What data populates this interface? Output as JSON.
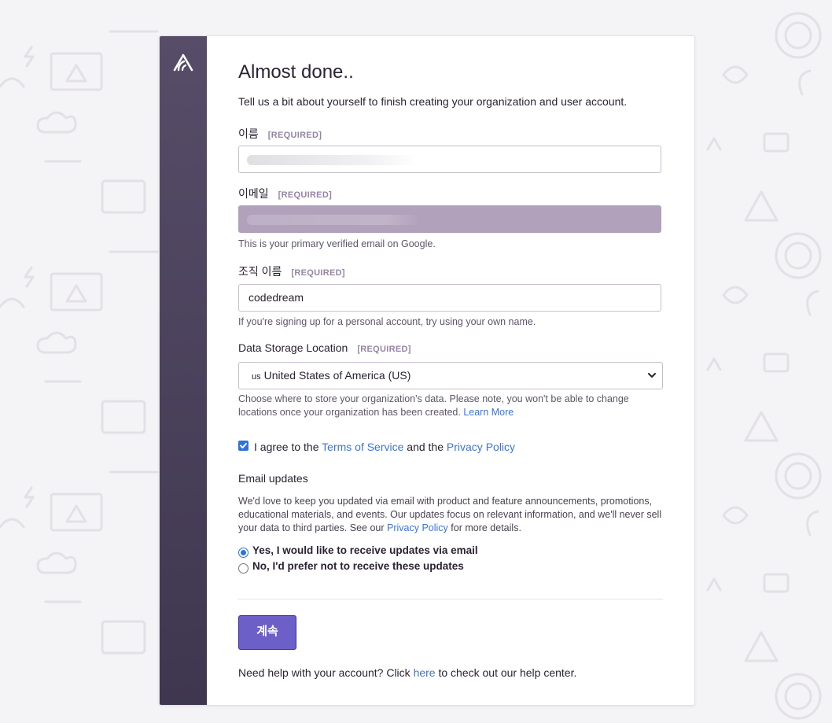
{
  "header": {
    "title": "Almost done..",
    "subtitle": "Tell us a bit about yourself to finish creating your organization and user account."
  },
  "form": {
    "name": {
      "label": "이름",
      "required": "[REQUIRED]",
      "value": ""
    },
    "email": {
      "label": "이메일",
      "required": "[REQUIRED]",
      "value": "",
      "help": "This is your primary verified email on Google."
    },
    "org": {
      "label": "조직 이름",
      "required": "[REQUIRED]",
      "value": "codedream",
      "help": "If you're signing up for a personal account, try using your own name."
    },
    "storage": {
      "label": "Data Storage Location",
      "required": "[REQUIRED]",
      "flag": "us",
      "selected": "United States of America (US)",
      "help": "Choose where to store your organization's data. Please note, you won't be able to change locations once your organization has been created.",
      "help_link": "Learn More"
    },
    "terms": {
      "checked": true,
      "prefix": "I agree to the",
      "terms_link": "Terms of Service",
      "middle": "and the",
      "privacy_link": "Privacy Policy"
    },
    "updates": {
      "title": "Email updates",
      "description": "We'd love to keep you updated via email with product and feature announcements, promotions, educational materials, and events. Our updates focus on relevant information, and we'll never sell your data to third parties. See our",
      "privacy_link": "Privacy Policy",
      "description_suffix": "for more details.",
      "options": [
        {
          "label": "Yes, I would like to receive updates via email",
          "checked": true
        },
        {
          "label": "No, I'd prefer not to receive these updates",
          "checked": false
        }
      ]
    },
    "submit_label": "계속"
  },
  "footer": {
    "prefix": "Need help with your account? Click",
    "link": "here",
    "suffix": "to check out our help center."
  },
  "colors": {
    "sidebar": "#4b4259",
    "accent": "#6c5fc7",
    "link": "#3d74db"
  }
}
